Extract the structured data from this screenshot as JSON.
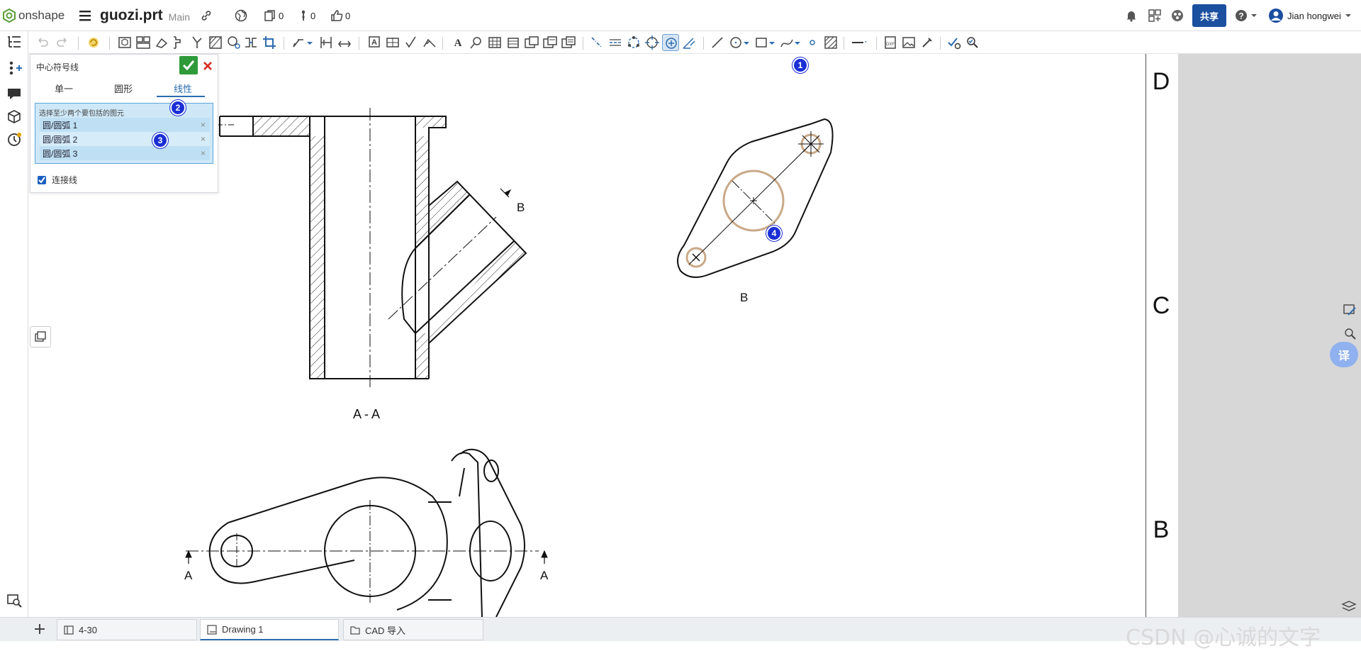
{
  "header": {
    "brand": "onshape",
    "doc_title": "guozi.prt",
    "workspace": "Main",
    "versions_count": "0",
    "branches_count": "0",
    "likes_count": "0",
    "share_label": "共享",
    "user_name": "Jian hongwei"
  },
  "panel": {
    "title": "中心符号线",
    "tabs": [
      "单一",
      "圆形",
      "线性"
    ],
    "active_tab": "线性",
    "selection_hint": "选择至少两个要包括的图元",
    "selections": [
      "圆/圆弧 1",
      "圆/圆弧 2",
      "圆/圆弧 3"
    ],
    "checkbox_label": "连接线",
    "checkbox_checked": true
  },
  "drawing": {
    "section_label": "A - A",
    "view_label": "B",
    "section_arrow_label": "B",
    "cut_label_left": "A",
    "cut_label_right": "A",
    "zone_labels": [
      "D",
      "C",
      "B"
    ]
  },
  "badges": [
    "1",
    "2",
    "3",
    "4"
  ],
  "tabs": [
    "4-30",
    "Drawing 1",
    "CAD 导入"
  ],
  "active_tab": "Drawing 1",
  "watermark": "CSDN @心诚的文字",
  "colors": {
    "brand_green": "#5a9f3a",
    "share_blue": "#1b4fa0",
    "accept_green": "#2e9a3a",
    "cancel_red": "#d4271e",
    "selection_bg": "#cfe8f7",
    "selected_circle": "#c9a988",
    "badge_blue": "#1a2fd4",
    "active_tab_blue": "#2b6cb0"
  }
}
